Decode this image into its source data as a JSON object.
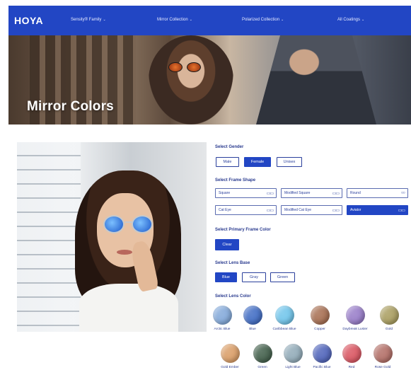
{
  "nav": {
    "logo": "HOYA",
    "items": [
      {
        "label": "Sensity® Family"
      },
      {
        "label": "Mirror Collection"
      },
      {
        "label": "Polarized Collection"
      },
      {
        "label": "All Coatings"
      }
    ]
  },
  "hero": {
    "title": "Mirror Colors"
  },
  "selectors": {
    "gender": {
      "label": "Select Gender",
      "options": [
        "Male",
        "Female",
        "Unisex"
      ],
      "selected": "Female"
    },
    "frame_shape": {
      "label": "Select Frame Shape",
      "options": [
        "Square",
        "Modified Square",
        "Round",
        "Cat Eye",
        "Modified Cat Eye",
        "Aviator"
      ],
      "selected": "Aviator"
    },
    "primary_frame_color": {
      "label": "Select Primary Frame Color",
      "options": [
        "Clear"
      ],
      "selected": "Clear"
    },
    "lens_base": {
      "label": "Select Lens Base",
      "options": [
        "Blue",
        "Gray",
        "Green"
      ],
      "selected": "Blue"
    },
    "lens_color": {
      "label": "Select Lens Color",
      "swatches": [
        {
          "name": "Arctic Blue",
          "color": "#7fa6d8"
        },
        {
          "name": "Blue",
          "color": "#3b68c2"
        },
        {
          "name": "Caribbean Blue",
          "color": "#6cc3ea"
        },
        {
          "name": "Copper",
          "color": "#a46a4c"
        },
        {
          "name": "Daybreak Luster",
          "color": "#9478c6"
        },
        {
          "name": "Gold",
          "color": "#a69a5a"
        },
        {
          "name": "Gold Ember",
          "color": "#d89a62"
        },
        {
          "name": "Green",
          "color": "#3c5a45"
        },
        {
          "name": "Light Blue",
          "color": "#8ea8b6"
        },
        {
          "name": "Pacific Blue",
          "color": "#4a5fb8"
        },
        {
          "name": "Red",
          "color": "#d8505c"
        },
        {
          "name": "Rose Gold",
          "color": "#b06a62"
        }
      ]
    }
  }
}
